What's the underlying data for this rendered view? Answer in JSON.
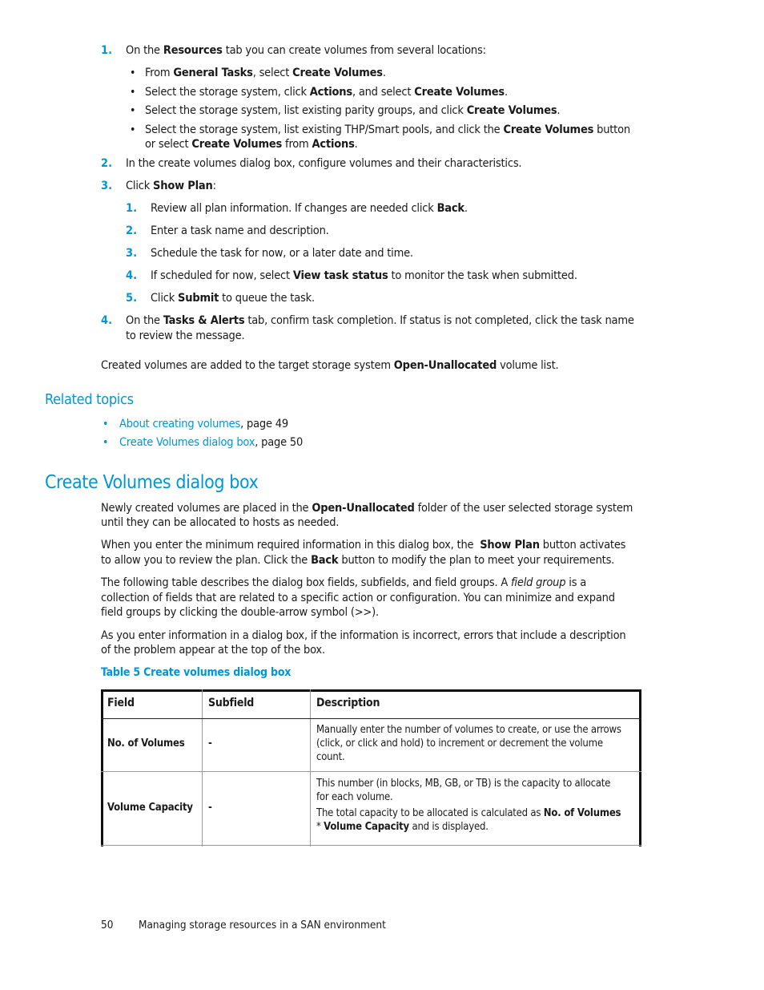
{
  "steps": [
    {
      "n": "1.",
      "parts": [
        "On the ",
        "Resources",
        " tab you can create volumes from several locations:"
      ]
    },
    {
      "n": "2.",
      "text": "In the create volumes dialog box, configure volumes and their characteristics."
    },
    {
      "n": "3.",
      "parts": [
        "Click ",
        "Show Plan",
        ":"
      ]
    },
    {
      "n": "4.",
      "parts": [
        "On the ",
        "Tasks & Alerts",
        " tab, confirm task completion. If status is not completed, click the task name"
      ],
      "cont": "to review the message."
    }
  ],
  "step1_bullets": [
    {
      "parts": [
        "From ",
        "General Tasks",
        ", select ",
        "Create Volumes",
        "."
      ]
    },
    {
      "parts": [
        "Select the storage system, click ",
        "Actions",
        ", and select ",
        "Create Volumes",
        "."
      ]
    },
    {
      "parts": [
        "Select the storage system, list existing parity groups, and click ",
        "Create Volumes",
        "."
      ]
    },
    {
      "parts": [
        "Select the storage system, list existing THP/Smart pools, and click the ",
        "Create Volumes",
        " button"
      ],
      "cont": [
        "or select ",
        "Create Volumes",
        " from ",
        "Actions",
        "."
      ]
    }
  ],
  "step3_substeps": [
    {
      "n": "1.",
      "parts": [
        "Review all plan information. If changes are needed click ",
        "Back",
        "."
      ]
    },
    {
      "n": "2.",
      "parts": [
        "Enter a task name and description.",
        "",
        ""
      ]
    },
    {
      "n": "3.",
      "parts": [
        "Schedule the task for now, or a later date and time.",
        "",
        ""
      ]
    },
    {
      "n": "4.",
      "parts": [
        "If scheduled for now, select ",
        "View task status",
        " to monitor the task when submitted."
      ]
    },
    {
      "n": "5.",
      "parts": [
        "Click ",
        "Submit",
        " to queue the task."
      ]
    }
  ],
  "created_note": [
    "Created volumes are added to the target storage system ",
    "Open-Unallocated",
    " volume list."
  ],
  "related": {
    "heading": "Related topics",
    "items": [
      {
        "link": "About creating volumes",
        "suffix": ", page 49"
      },
      {
        "link": "Create Volumes dialog box",
        "suffix": ", page 50"
      }
    ]
  },
  "section": {
    "title": "Create Volumes dialog box",
    "p1": [
      "Newly created volumes are placed in the ",
      "Open-Unallocated",
      " folder of the user selected storage system",
      "until they can be allocated to hosts as needed."
    ],
    "p2": [
      "When you enter the minimum required information in this dialog box, the  ",
      "Show Plan",
      " button activates",
      "to allow you to review the plan. Click the ",
      "Back",
      " button to modify the plan to meet your requirements."
    ],
    "p3": [
      "The following table describes the dialog box fields, subfields, and field groups. A ",
      "field group",
      " is a",
      "collection of fields that are related to a specific action or configuration. You can minimize and expand",
      "field groups by clicking the double-arrow symbol (>>)."
    ],
    "p4": [
      "As you enter information in a dialog box, if the information is incorrect, errors that include a description",
      "of the problem appear at the top of the box."
    ]
  },
  "table": {
    "caption": "Table 5 Create volumes dialog box",
    "headers": [
      "Field",
      "Subfield",
      "Description"
    ],
    "rows": [
      {
        "field": "No. of Volumes",
        "subfield": "-",
        "desc_lines": [
          "Manually enter the number of volumes to create, or use the arrows",
          "(click, or click and hold) to increment or decrement the volume",
          "count."
        ]
      },
      {
        "field": "Volume Capacity",
        "subfield": "-",
        "desc_lines": [
          "This number (in blocks, MB, GB, or TB) is the capacity to allocate",
          "for each volume."
        ],
        "desc2": [
          "The total capacity to be allocated is calculated as ",
          "No. of Volumes",
          "* ",
          "Volume Capacity",
          " and is displayed."
        ]
      }
    ]
  },
  "footer": {
    "page_number": "50",
    "chapter": "Managing storage resources in a SAN environment"
  }
}
